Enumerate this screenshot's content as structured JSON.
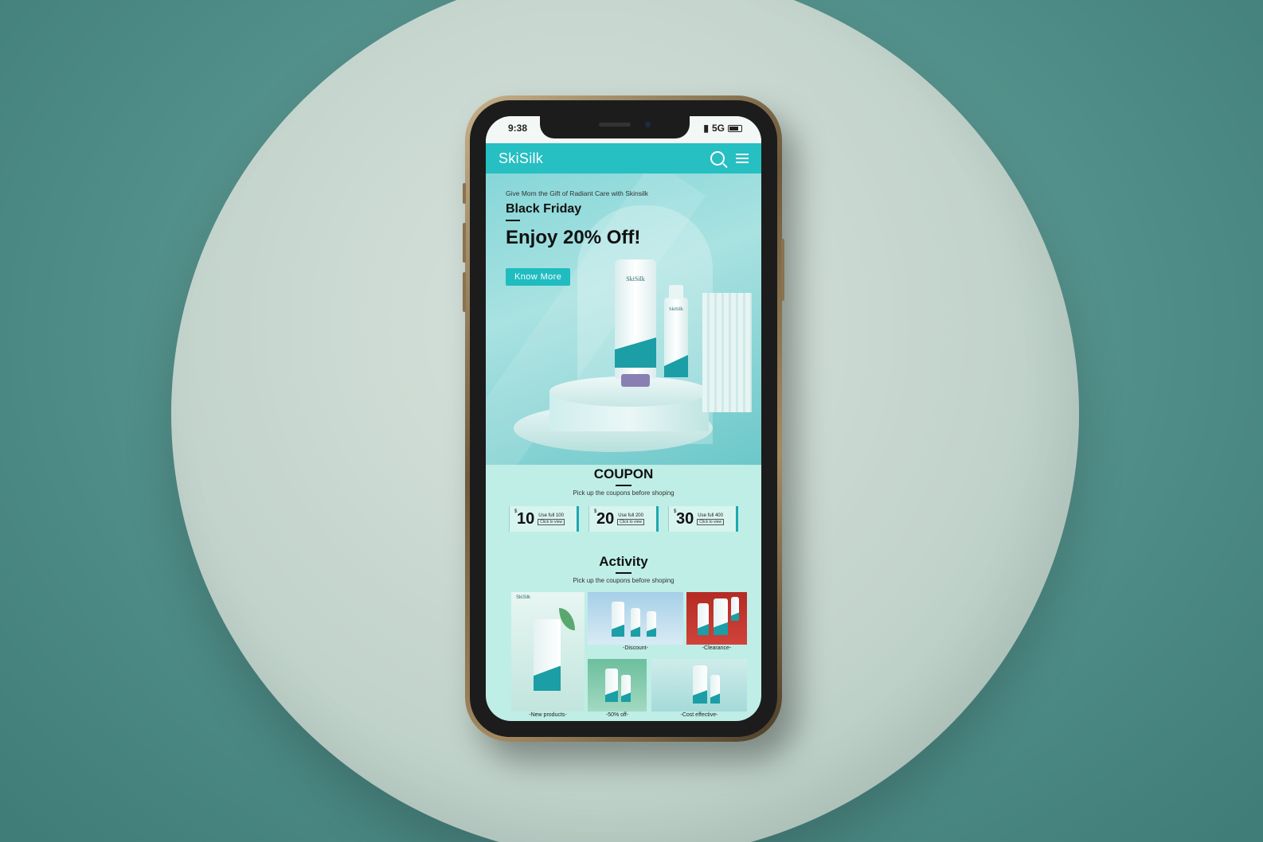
{
  "status_bar": {
    "time": "9:38",
    "signal": "5G"
  },
  "app": {
    "brand": "SkiSilk"
  },
  "hero": {
    "eyebrow": "Give Mom the Gift of Radiant Care with Skinsilk",
    "subtitle": "Black Friday",
    "title": "Enjoy 20% Off!",
    "cta": "Know More",
    "product_label_tube": "SkiSilk",
    "product_label_bottle": "SkiSilk"
  },
  "coupon_section": {
    "title": "COUPON",
    "subtitle": "Pick up the coupons before shoping",
    "coupons": [
      {
        "currency": "$",
        "amount": "10",
        "condition": "Use full 100",
        "action": "Click to view"
      },
      {
        "currency": "$",
        "amount": "20",
        "condition": "Use full 200",
        "action": "Click to view"
      },
      {
        "currency": "$",
        "amount": "30",
        "condition": "Use full 400",
        "action": "Click to view"
      }
    ]
  },
  "activity_section": {
    "title": "Activity",
    "subtitle": "Pick up the coupons before shoping",
    "tiles": {
      "new_products": "-New products-",
      "discount": "-Discount-",
      "clearance": "-Clearance-",
      "fifty_off": "-50% off-",
      "cost_effective": "-Cost effective-",
      "brand_mark": "SkiSilk"
    }
  },
  "colors": {
    "accent": "#26bfc2",
    "background": "#bfeee6"
  }
}
